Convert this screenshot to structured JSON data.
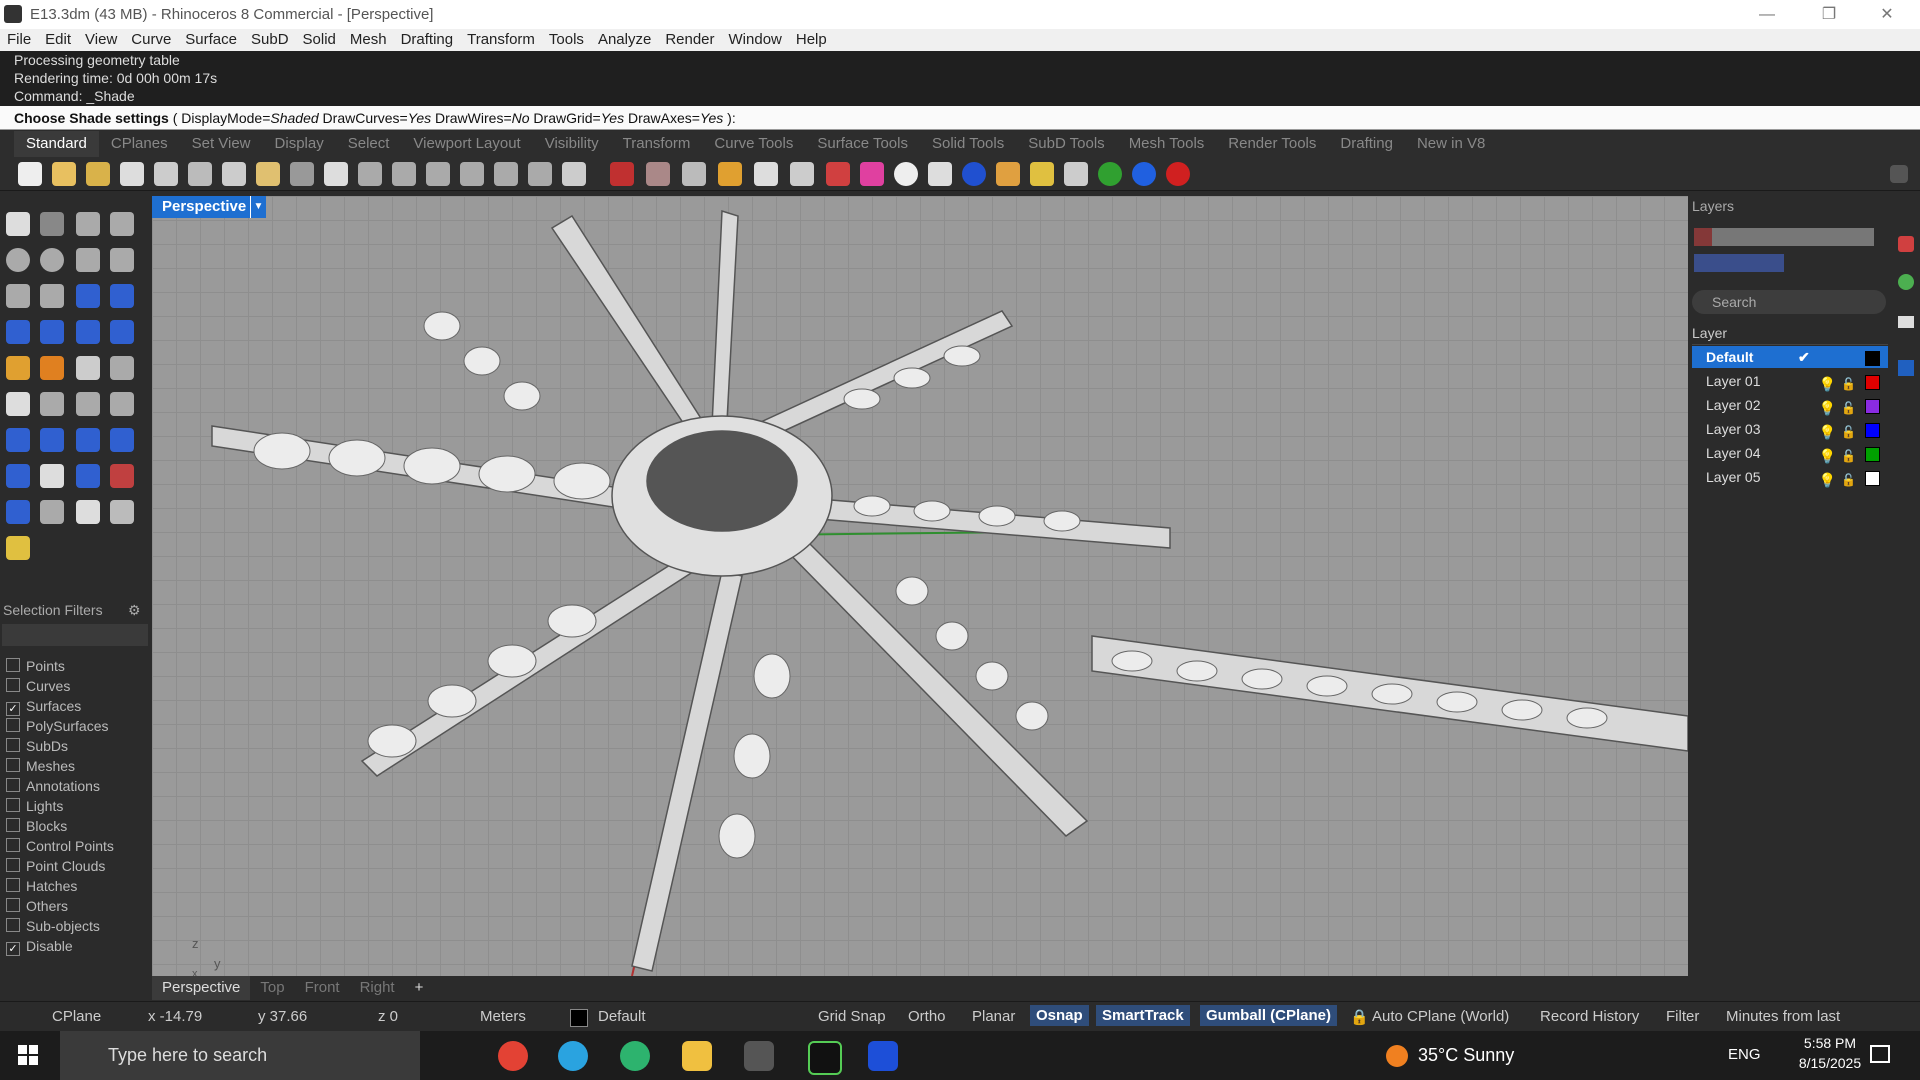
{
  "window": {
    "title": "E13.3dm (43 MB) - Rhinoceros 8 Commercial - [Perspective]",
    "minimize": "—",
    "restore": "❐",
    "close": "✕"
  },
  "menu": [
    "File",
    "Edit",
    "View",
    "Curve",
    "Surface",
    "SubD",
    "Solid",
    "Mesh",
    "Drafting",
    "Transform",
    "Tools",
    "Analyze",
    "Render",
    "Window",
    "Help"
  ],
  "command_history": [
    "Processing geometry table",
    "Rendering time: 0d 00h 00m 17s",
    "Command: _Shade"
  ],
  "prompt": {
    "label": "Choose Shade settings",
    "open": " ( ",
    "k1": "DisplayMode=",
    "v1": "Shaded",
    "k2": " DrawCurves=",
    "v2": "Yes",
    "k3": " DrawWires=",
    "v3": "No",
    "k4": " DrawGrid=",
    "v4": "Yes",
    "k5": " DrawAxes=",
    "v5": "Yes",
    "close": " ):"
  },
  "toolbar_tabs": [
    "Standard",
    "CPlanes",
    "Set View",
    "Display",
    "Select",
    "Viewport Layout",
    "Visibility",
    "Transform",
    "Curve Tools",
    "Surface Tools",
    "Solid Tools",
    "SubD Tools",
    "Mesh Tools",
    "Render Tools",
    "Drafting",
    "New in V8"
  ],
  "selection_filters": {
    "title": "Selection Filters",
    "items": [
      {
        "label": "Points",
        "checked": false
      },
      {
        "label": "Curves",
        "checked": false
      },
      {
        "label": "Surfaces",
        "checked": true
      },
      {
        "label": "PolySurfaces",
        "checked": false
      },
      {
        "label": "SubDs",
        "checked": false
      },
      {
        "label": "Meshes",
        "checked": false
      },
      {
        "label": "Annotations",
        "checked": false
      },
      {
        "label": "Lights",
        "checked": false
      },
      {
        "label": "Blocks",
        "checked": false
      },
      {
        "label": "Control Points",
        "checked": false
      },
      {
        "label": "Point Clouds",
        "checked": false
      },
      {
        "label": "Hatches",
        "checked": false
      },
      {
        "label": "Others",
        "checked": false
      },
      {
        "label": "Sub-objects",
        "checked": false
      },
      {
        "label": "Disable",
        "checked": true
      }
    ]
  },
  "viewport": {
    "title": "Perspective",
    "dropdown": "▼",
    "tabs": [
      "Perspective",
      "Top",
      "Front",
      "Right"
    ],
    "add_tab": "+",
    "axis_z": "z",
    "axis_y": "y",
    "axis_x": "x"
  },
  "layers": {
    "title": "Layers",
    "search_placeholder": "Search",
    "column_header": "Layer",
    "rows": [
      {
        "name": "Default",
        "color": "#000000",
        "current": true,
        "check": "✔"
      },
      {
        "name": "Layer 01",
        "color": "#e00000",
        "current": false
      },
      {
        "name": "Layer 02",
        "color": "#8a2be2",
        "current": false
      },
      {
        "name": "Layer 03",
        "color": "#0000ff",
        "current": false
      },
      {
        "name": "Layer 04",
        "color": "#00a000",
        "current": false
      },
      {
        "name": "Layer 05",
        "color": "#ffffff",
        "current": false
      }
    ]
  },
  "status": {
    "cplane": "CPlane",
    "x": "x -14.79",
    "y": "y 37.66",
    "z": "z 0",
    "units": "Meters",
    "layer": "Default",
    "grid_snap": "Grid Snap",
    "ortho": "Ortho",
    "planar": "Planar",
    "osnap": "Osnap",
    "smarttrack": "SmartTrack",
    "gumball": "Gumball (CPlane)",
    "autocplane": "Auto CPlane (World)",
    "record_history": "Record History",
    "filter": "Filter",
    "minutes": "Minutes from last"
  },
  "taskbar": {
    "search_placeholder": "Type here to search",
    "weather": "35°C  Sunny",
    "lang": "ENG",
    "time": "5:58 PM",
    "date": "8/15/2025"
  }
}
